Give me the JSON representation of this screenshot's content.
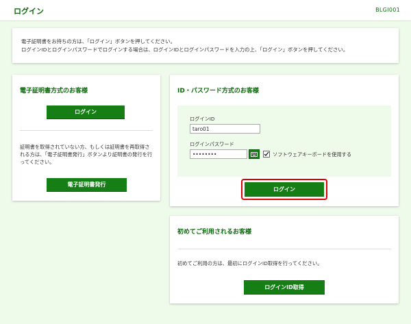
{
  "header": {
    "title": "ログイン",
    "screen_code": "BLGI001"
  },
  "notice": {
    "line1": "電子証明書をお持ちの方は、「ログイン」ボタンを押してください。",
    "line2": "ログインIDとログインパスワードでログインする場合は、ログインIDとログインパスワードを入力の上、「ログイン」ボタンを押してください。"
  },
  "cert_panel": {
    "title": "電子証明書方式のお客様",
    "login_label": "ログイン",
    "description": "証明書を取得されていない方、もしくは証明書を再取得される方は、「電子証明書発行」ボタンより証明書の発行を行ってください。",
    "issue_label": "電子証明書発行"
  },
  "idpw_panel": {
    "title": "ID・パスワード方式のお客様",
    "id_label": "ログインID",
    "id_value": "taro01",
    "password_label": "ログインパスワード",
    "password_value": "••••••••",
    "software_keyboard_label": "ソフトウェアキーボードを使用する",
    "software_keyboard_checked": true,
    "login_label": "ログイン",
    "highlight_color": "#e00000"
  },
  "first_panel": {
    "title": "初めてご利用されるお客様",
    "description": "初めてご利用の方は、最初にログインID取得を行ってください。",
    "get_id_label": "ログインID取得"
  },
  "icons": {
    "keyboard": "keyboard-icon",
    "checkbox": "check-icon"
  },
  "colors": {
    "brand": "#0a6b0a",
    "button": "#157f15",
    "background": "#eefaea"
  }
}
